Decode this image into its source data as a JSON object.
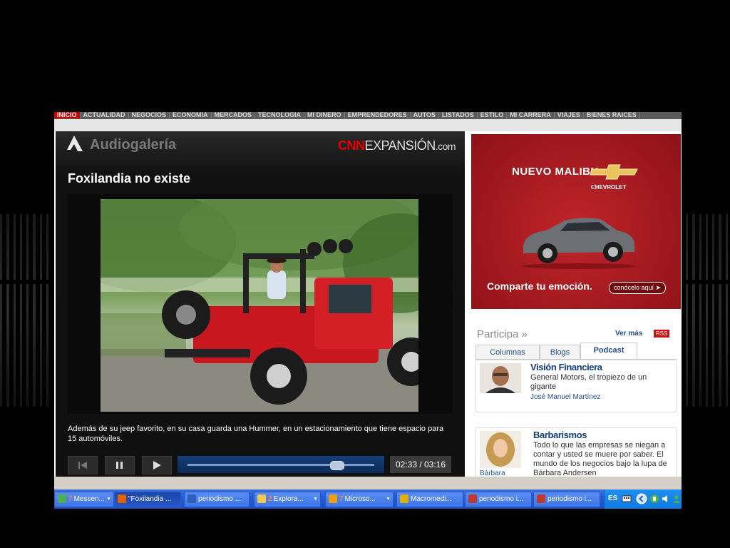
{
  "nav": {
    "items": [
      "INICIO",
      "ACTUALIDAD",
      "NEGOCIOS",
      "ECONOMÍA",
      "MERCADOS",
      "TECNOLOGÍA",
      "MI DINERO",
      "EMPRENDEDORES",
      "AUTOS",
      "LISTADOS",
      "ESTILO",
      "MI CARRERA",
      "VIAJES",
      "BIENES RAÍCES"
    ],
    "active_index": 0
  },
  "player": {
    "section_title": "Audiogalería",
    "brand_cnn": "CNN",
    "brand_expansion": "EXPANSIÓN",
    "brand_domain": ".com",
    "video_title": "Foxilandia no existe",
    "caption": "Además de su jeep favorito, en su casa guarda una Hummer, en un estacionamiento que tiene espacio para 15 automóviles.",
    "time_display": "02:33 / 03:16",
    "progress": 0.8
  },
  "ad": {
    "headline": "NUEVO MALIBU",
    "brand": "CHEVROLET",
    "tagline": "Comparte tu emoción.",
    "cta": "conócelo aquí",
    "bg_color": "#b01e24"
  },
  "participa": {
    "title": "Participa »",
    "more": "Ver más",
    "rss": "RSS",
    "tabs": [
      {
        "label": "Columnas",
        "active": false
      },
      {
        "label": "Blogs",
        "active": false
      },
      {
        "label": "Podcast",
        "active": true
      }
    ],
    "entries": [
      {
        "title": "Visión Financiera",
        "description": "General Motors, el tropiezo de un gigante",
        "author": "José Manuel Martínez"
      },
      {
        "title": "Barbarismos",
        "description": "Todo lo que las empresas se niegan a contar y usted se muere por saber. El mundo de los negocios bajo la lupa de Bárbara Andersen",
        "author": "Bárbara"
      }
    ]
  },
  "taskbar": {
    "items": [
      {
        "label": "Messen...",
        "count": "7",
        "icon": "messenger-icon",
        "dropdown": true,
        "active": false
      },
      {
        "label": "\"Foxilandia ...",
        "count": "",
        "icon": "firefox-icon",
        "dropdown": false,
        "active": true
      },
      {
        "label": "periodismo ...",
        "count": "",
        "icon": "word-icon",
        "dropdown": false,
        "active": false
      },
      {
        "label": "Explora...",
        "count": "2",
        "icon": "folder-icon",
        "dropdown": true,
        "active": false
      },
      {
        "label": "Microso...",
        "count": "7",
        "icon": "office-icon",
        "dropdown": true,
        "active": false
      },
      {
        "label": "Macromedi...",
        "count": "",
        "icon": "macromedia-icon",
        "dropdown": false,
        "active": false
      },
      {
        "label": "periodismo i...",
        "count": "",
        "icon": "acrobat-icon",
        "dropdown": false,
        "active": false
      },
      {
        "label": "periodismo i...",
        "count": "",
        "icon": "acrobat-icon",
        "dropdown": false,
        "active": false
      }
    ],
    "tray_language": "ES"
  }
}
